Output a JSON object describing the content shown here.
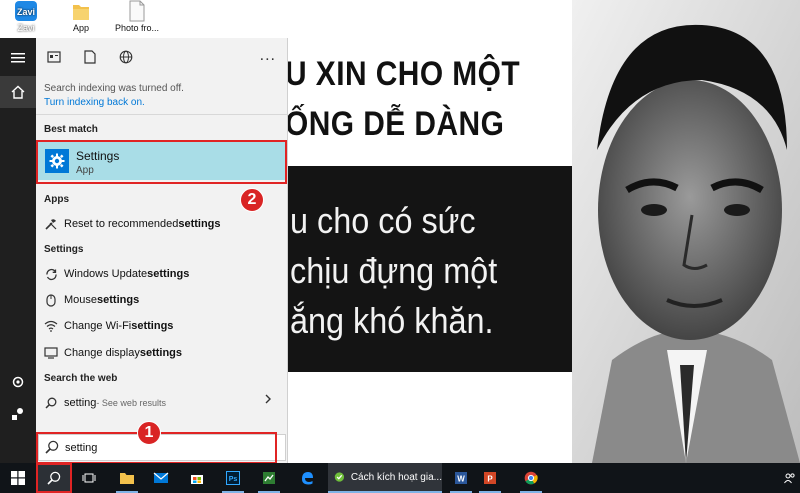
{
  "desktop": {
    "icons": [
      {
        "label": "Zavi"
      },
      {
        "label": "App"
      },
      {
        "label": "Photo fro..."
      }
    ],
    "wallpaper": {
      "heading_line1": "U XIN CHO MỘT",
      "heading_line2": "ỐNG DỄ DÀNG",
      "body_line1": "u cho có sức",
      "body_line2": "chịu đựng một",
      "body_line3": "ắng khó khăn."
    }
  },
  "search_pane": {
    "notice_text": "Search indexing was turned off.",
    "notice_link": "Turn indexing back on.",
    "best_match_header": "Best match",
    "best_match": {
      "title": "Settings",
      "subtitle": "App"
    },
    "apps_header": "Apps",
    "apps_items": [
      {
        "prefix": "Reset to recommended ",
        "bold": "settings"
      }
    ],
    "settings_header": "Settings",
    "settings_items": [
      {
        "prefix": "Windows Update ",
        "bold": "settings"
      },
      {
        "prefix": "Mouse ",
        "bold": "settings"
      },
      {
        "prefix": "Change Wi-Fi ",
        "bold": "settings"
      },
      {
        "prefix": "Change display ",
        "bold": "settings"
      }
    ],
    "web_header": "Search the web",
    "web_item": {
      "query": "setting",
      "suffix": " - See web results"
    },
    "more_label": "...",
    "search_value": "setting"
  },
  "annotations": {
    "step1": "1",
    "step2": "2"
  },
  "taskbar": {
    "active_window_title": "Cách kích hoạt gia..."
  },
  "colors": {
    "accent": "#0078d7",
    "highlight": "#a9dde7",
    "annotation_red": "#e02424",
    "taskbar": "#101418"
  }
}
